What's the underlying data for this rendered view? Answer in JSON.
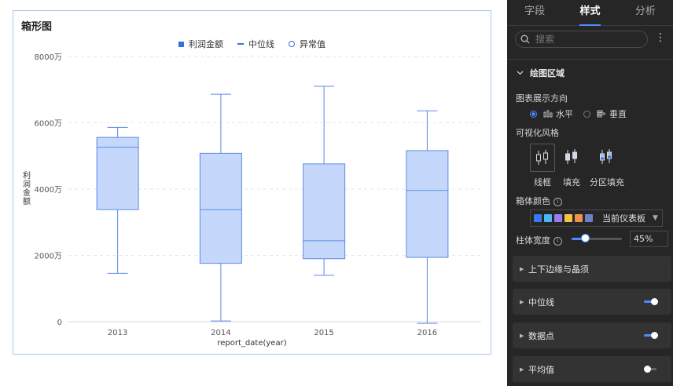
{
  "card": {
    "title": "箱形图"
  },
  "legend": {
    "items": [
      "利润金额",
      "中位线",
      "异常值"
    ]
  },
  "chart_data": {
    "type": "box",
    "title": "箱形图",
    "xlabel": "report_date(year)",
    "ylabel": "利润金额",
    "y_ticks": [
      "0",
      "2000万",
      "4000万",
      "6000万",
      "8000万"
    ],
    "ylim": [
      0,
      80000000
    ],
    "categories": [
      "2013",
      "2014",
      "2015",
      "2016"
    ],
    "boxes": [
      {
        "category": "2013",
        "min": 14600000,
        "q1": 33800000,
        "median": 52600000,
        "q3": 55600000,
        "max": 58600000
      },
      {
        "category": "2014",
        "min": 200000,
        "q1": 17600000,
        "median": 33800000,
        "q3": 50800000,
        "max": 68600000
      },
      {
        "category": "2015",
        "min": 14000000,
        "q1": 19000000,
        "median": 24400000,
        "q3": 47600000,
        "max": 71000000
      },
      {
        "category": "2016",
        "min": -500000,
        "q1": 19400000,
        "median": 39600000,
        "q3": 51600000,
        "max": 63600000
      }
    ],
    "colors": {
      "fill": "#c5d8fb",
      "stroke": "#5b8ae6",
      "grid": "#e6e6e6"
    }
  },
  "panel": {
    "tabs": [
      "字段",
      "样式",
      "分析"
    ],
    "active_tab": "样式",
    "search_placeholder": "搜索",
    "section_title": "绘图区域",
    "direction_label": "图表展示方向",
    "direction_options": [
      "水平",
      "垂直"
    ],
    "direction_selected": "水平",
    "style_label": "可视化风格",
    "style_options": [
      "线框",
      "填充",
      "分区填充"
    ],
    "box_color_label": "箱体颜色",
    "palette_text": "当前仪表板",
    "palette_swatches": [
      "#3a78f2",
      "#4cb6f5",
      "#9a7bf0",
      "#f5c24c",
      "#f0924c",
      "#6a83c6"
    ],
    "bar_width_label": "柱体宽度",
    "bar_width_value": "45%",
    "bar_width_fraction": 0.45,
    "collapsibles": [
      {
        "title": "上下边缘与晶须",
        "toggle": null
      },
      {
        "title": "中位线",
        "toggle": true
      },
      {
        "title": "数据点",
        "toggle": true
      },
      {
        "title": "平均值",
        "toggle": false
      }
    ],
    "accent": "#4a8cff"
  }
}
